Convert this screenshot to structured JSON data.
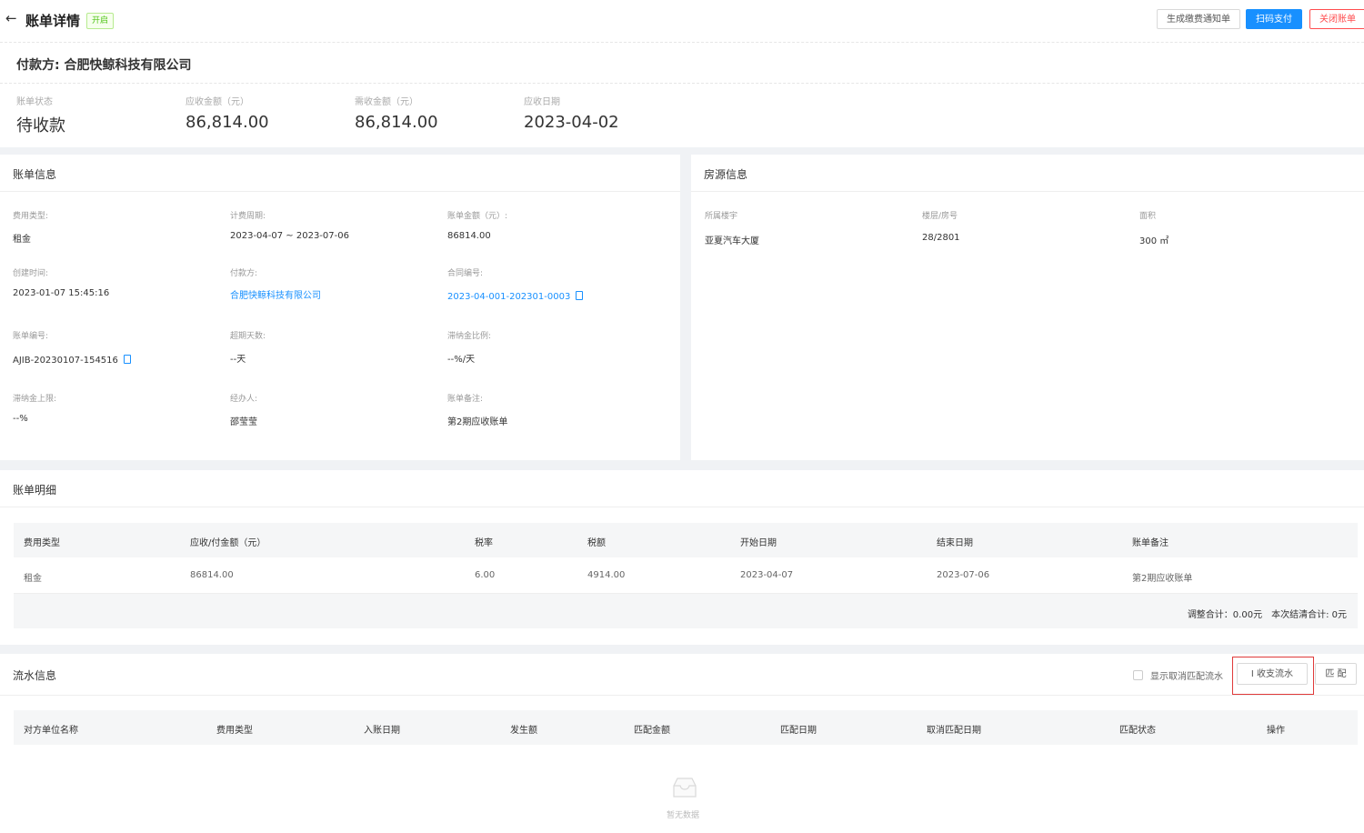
{
  "header": {
    "back_icon": "←",
    "title": "账单详情",
    "tag": "开启",
    "buttons": {
      "notice": "生成缴费通知单",
      "scan_pay": "扫码支付",
      "close": "关闭账单"
    },
    "payer": "付款方: 合肥快鲸科技有限公司",
    "stats": [
      {
        "label": "账单状态",
        "value": "待收款"
      },
      {
        "label": "应收金额（元）",
        "value": "86,814.00"
      },
      {
        "label": "需收金额（元）",
        "value": "86,814.00"
      },
      {
        "label": "应收日期",
        "value": "2023-04-02"
      }
    ]
  },
  "bill_info": {
    "title": "账单信息",
    "fields": [
      {
        "label": "费用类型:",
        "value": "租金"
      },
      {
        "label": "计费周期:",
        "value": "2023-04-07 ~ 2023-07-06"
      },
      {
        "label": "账单金额（元）:",
        "value": "86814.00"
      },
      {
        "label": "创建时间:",
        "value": "2023-01-07 15:45:16"
      },
      {
        "label": "付款方:",
        "value": "合肥快鲸科技有限公司"
      },
      {
        "label": "合同编号:",
        "value": "2023-04-001-202301-0003"
      },
      {
        "label": "账单编号:",
        "value": "AJIB-20230107-154516"
      },
      {
        "label": "超期天数:",
        "value": "--天"
      },
      {
        "label": "滞纳金比例:",
        "value": "--%/天"
      },
      {
        "label": "滞纳金上限:",
        "value": "--%"
      },
      {
        "label": "经办人:",
        "value": "邵莹莹"
      },
      {
        "label": "账单备注:",
        "value": "第2期应收账单"
      }
    ]
  },
  "property_info": {
    "title": "房源信息",
    "fields": [
      {
        "label": "所属楼宇",
        "value": "亚夏汽车大厦"
      },
      {
        "label": "楼层/房号",
        "value": "28/2801"
      },
      {
        "label": "面积",
        "value": "300 ㎡"
      }
    ]
  },
  "bill_detail": {
    "title": "账单明细",
    "columns": [
      "费用类型",
      "应收/付金额（元）",
      "税率",
      "税额",
      "开始日期",
      "结束日期",
      "账单备注"
    ],
    "rows": [
      [
        "租金",
        "86814.00",
        "6.00",
        "4914.00",
        "2023-04-07",
        "2023-07-06",
        "第2期应收账单"
      ]
    ],
    "summary": "调整合计：0.00元　本次结清合计: 0元"
  },
  "flow_info": {
    "title": "流水信息",
    "show_cancelled_label": "显示取消匹配流水",
    "income_flow_button": "I 收支流水",
    "match_button": "匹 配",
    "columns": [
      "对方单位名称",
      "费用类型",
      "入账日期",
      "发生额",
      "匹配金额",
      "匹配日期",
      "取消匹配日期",
      "匹配状态",
      "操作"
    ],
    "empty_text": "暂无数据"
  },
  "colors": {
    "primary": "#1890ff",
    "danger": "#ff4d4f",
    "tag_green": "#52c41a",
    "highlight_box": "#e03a3a"
  }
}
